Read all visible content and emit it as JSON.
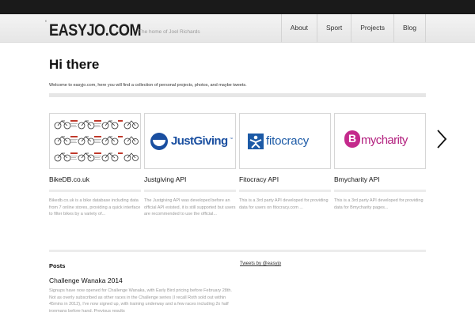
{
  "site": {
    "logo_mark": "‘",
    "logo": "EASYJO.COM",
    "tagline": "The home of Joel Richards"
  },
  "nav": {
    "items": [
      "About",
      "Sport",
      "Projects",
      "Blog"
    ]
  },
  "main": {
    "title": "Hi there",
    "intro": "Welcome to easyjo.com, here you will find a collection of personal projects, photos, and maybe tweets."
  },
  "projects": [
    {
      "title": "BikeDB.co.uk",
      "description": "Bikedb.co.uk is a bike database including data from 7 online stores, providing a quick interface to filter bikes by a variety of..."
    },
    {
      "title": "Justgiving API",
      "logo_text": "JustGiving",
      "logo_tm": "™",
      "description": "The Justgiving API was developed before an official API existed, it is still supported but users are recommended to use the official..."
    },
    {
      "title": "Fitocracy API",
      "logo_text": "fitocracy",
      "description": "This is a 3rd party API developed for providing data for users on fitocracy.com ..."
    },
    {
      "title": "Bmycharity API",
      "logo_mark": "B",
      "logo_text": "mycharity",
      "description": "This is a 3rd party API developed for providing data for Bmycharity pages..."
    }
  ],
  "posts": {
    "heading": "Posts",
    "items": [
      {
        "title": "Challenge Wanaka 2014",
        "excerpt": "Signups have now opened for Challenge Wanaka, with Early Bird pricing before February 28th. Not as overly subscribed as other races in the Challenge series (I recall Roth sold out within 45mins in 2012), I've now signed up, with training underway and a few races including 2x half ironmans before hand. Previous results"
      }
    ]
  },
  "tweets": {
    "link": "Tweets by @easyjo"
  },
  "colors": {
    "justgiving": "#1a4fa0",
    "fitocracy": "#1c5aa6",
    "bmycharity": "#b3217f",
    "bike_red": "#c0392b"
  },
  "icons": {
    "next": "chevron-right-icon"
  }
}
